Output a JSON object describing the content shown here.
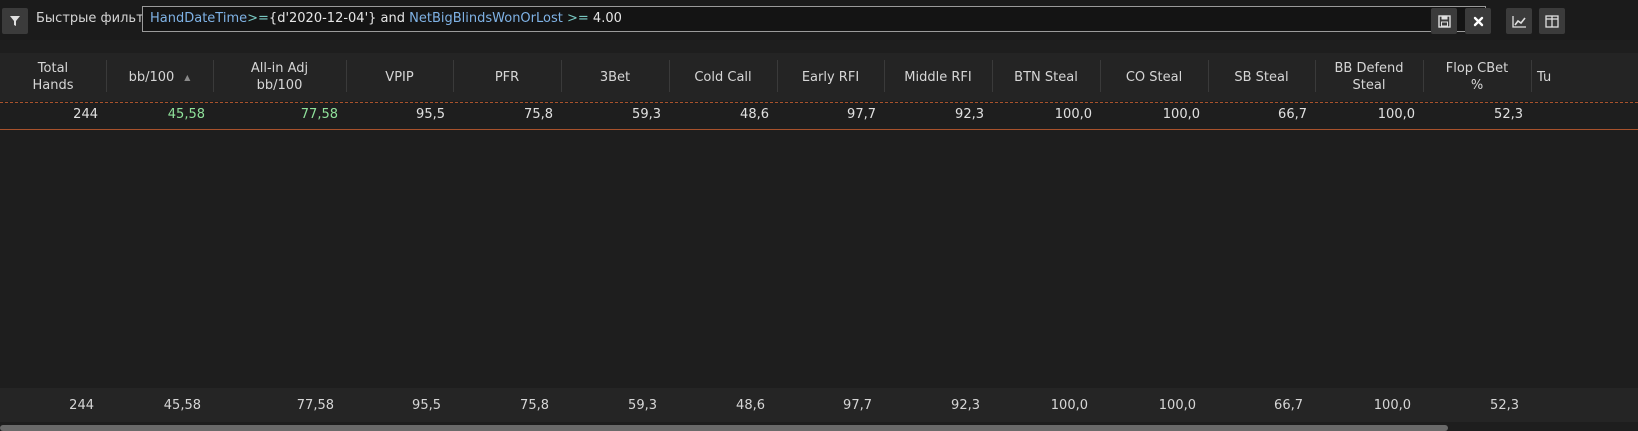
{
  "filter": {
    "label": "Быстрые фильт",
    "expression": [
      {
        "text": "HandDateTime",
        "kind": "field"
      },
      {
        "text": ">=",
        "kind": "op"
      },
      {
        "text": "{d'2020-12-04'} and ",
        "kind": "val"
      },
      {
        "text": "NetBigBlindsWonOrLost",
        "kind": "field"
      },
      {
        "text": " >= ",
        "kind": "op"
      },
      {
        "text": "4.00",
        "kind": "val"
      }
    ],
    "icons": {
      "filter": "funnel-icon",
      "save": "save-icon",
      "clear": "close-icon",
      "graph": "chart-line-icon",
      "layout": "columns-icon"
    }
  },
  "table": {
    "columns": [
      "Total\nHands",
      "bb/100",
      "All-in Adj\nbb/100",
      "VPIP",
      "PFR",
      "3Bet",
      "Cold Call",
      "Early RFI",
      "Middle RFI",
      "BTN Steal",
      "CO Steal",
      "SB Steal",
      "BB Defend\nSteal",
      "Flop CBet\n%",
      "Tu"
    ],
    "rows": [
      [
        "244",
        "45,58",
        "77,58",
        "95,5",
        "75,8",
        "59,3",
        "48,6",
        "97,7",
        "92,3",
        "100,0",
        "100,0",
        "66,7",
        "100,0",
        "52,3"
      ]
    ],
    "totals": [
      "244",
      "45,58",
      "77,58",
      "95,5",
      "75,8",
      "59,3",
      "48,6",
      "97,7",
      "92,3",
      "100,0",
      "100,0",
      "66,7",
      "100,0",
      "52,3"
    ],
    "sorted_column": "bb/100",
    "positive_color": "#8fe19a",
    "highlight_color": "#a8522c"
  }
}
